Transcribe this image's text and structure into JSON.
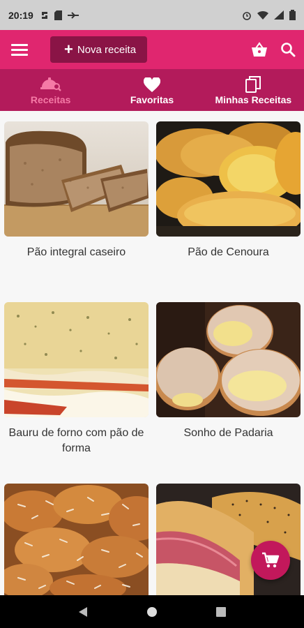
{
  "status": {
    "time": "20:19"
  },
  "appbar": {
    "new_recipe_label": "Nova receita"
  },
  "tabs": [
    {
      "label": "Receitas",
      "active": true
    },
    {
      "label": "Favoritas",
      "active": false
    },
    {
      "label": "Minhas Receitas",
      "active": false
    }
  ],
  "recipes": [
    {
      "title": "Pão integral caseiro"
    },
    {
      "title": "Pão de Cenoura"
    },
    {
      "title": "Bauru de forno com pão de forma"
    },
    {
      "title": "Sonho de Padaria"
    },
    {
      "title": ""
    },
    {
      "title": ""
    }
  ],
  "colors": {
    "primary": "#e0266f",
    "primary_dark": "#b31b5b",
    "button": "#8a1446",
    "active_tab": "#f57aa6",
    "fab": "#c2185b"
  }
}
